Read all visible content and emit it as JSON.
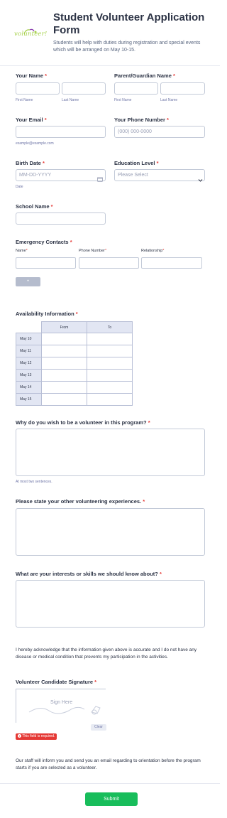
{
  "header": {
    "logo_text": "volunteer!",
    "title": "Student Volunteer Application Form",
    "subtitle": "Students will help with duties during registration and special events which will be arranged on May 10-15."
  },
  "name": {
    "label": "Your Name",
    "first": "First Name",
    "last": "Last Name"
  },
  "guardian": {
    "label": "Parent/Guardian Name",
    "first": "First Name",
    "last": "Last Name"
  },
  "email": {
    "label": "Your Email",
    "sublabel": "example@example.com"
  },
  "phone": {
    "label": "Your Phone Number",
    "placeholder": "(000) 000-0000"
  },
  "birth": {
    "label": "Birth Date",
    "placeholder": "MM-DD-YYYY",
    "sublabel": "Date"
  },
  "education": {
    "label": "Education Level",
    "selected": "Please Select"
  },
  "school": {
    "label": "School Name"
  },
  "emergency": {
    "label": "Emergency Contacts",
    "col_name": "Name",
    "col_phone": "Phone Number",
    "col_relationship": "Relationship",
    "add_button": "+"
  },
  "availability": {
    "label": "Availability Information",
    "col_from": "From",
    "col_to": "To",
    "days": [
      "May 10",
      "May 11",
      "May 12",
      "May 13",
      "May 14",
      "May 15"
    ]
  },
  "why": {
    "label": "Why do you wish to be a volunteer in this program?",
    "sublabel": "At most two sentences."
  },
  "experience": {
    "label": "Please state your other volunteering experiences."
  },
  "interests": {
    "label": "What are your interests or skills we should know about?"
  },
  "acknowledge": "I hereby acknowledge that the information given above is accurate and I do not have any disease or medical condition that prevents my participation in the activities.",
  "signature": {
    "label": "Volunteer Candidate Signature",
    "placeholder": "Sign Here",
    "clear": "Clear",
    "error": "This field is required."
  },
  "footer_note": "Our staff will inform you and send you an email regarding to orientation before the program starts if you are selected as a volunteer.",
  "submit": "Submit",
  "required_mark": "*",
  "colors": {
    "accent": "#18bd5b",
    "error": "#e53935",
    "label": "#2c3345",
    "sublabel": "#6f76a7",
    "logo_green": "#a6d14a",
    "logo_purple": "#8a3fae"
  },
  "icons": {
    "calendar": "calendar-icon",
    "chevron": "chevron-down-icon",
    "error": "error-icon"
  }
}
